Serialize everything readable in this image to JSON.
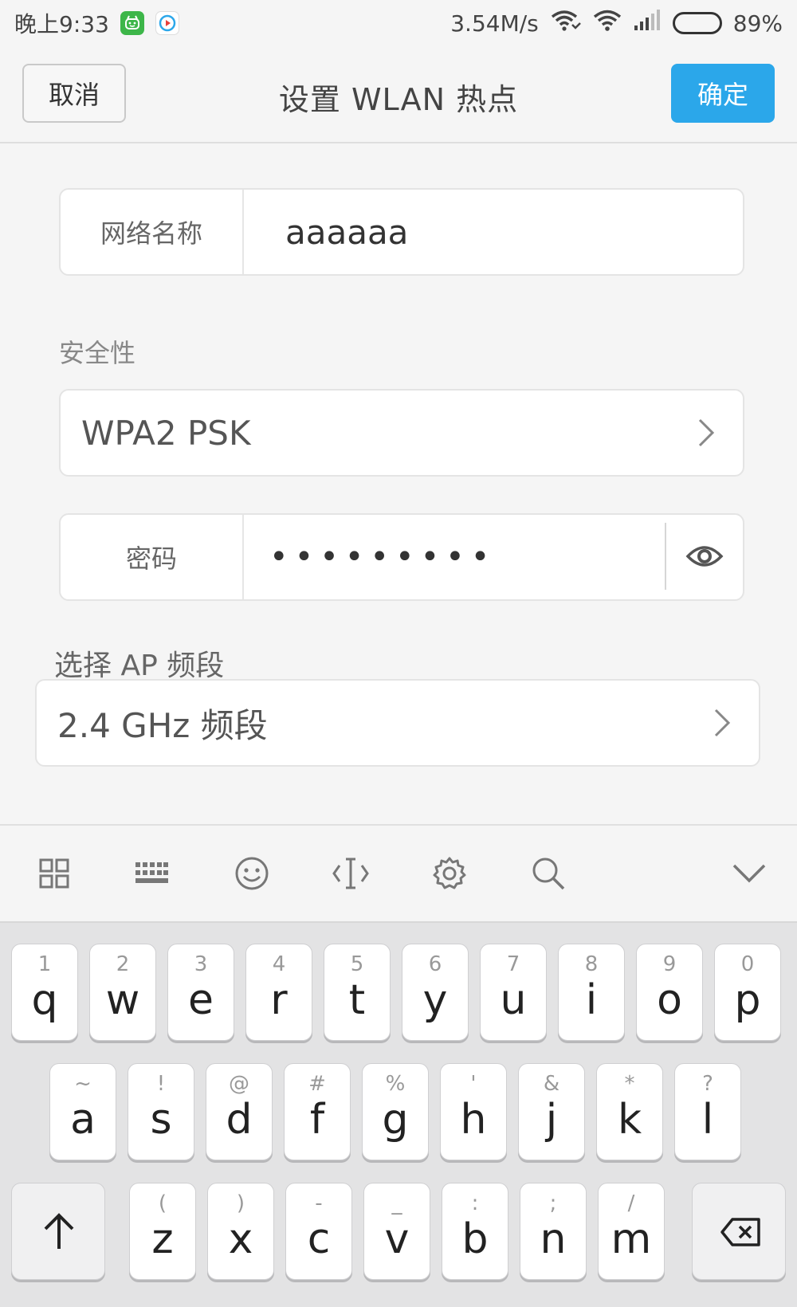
{
  "status": {
    "time": "晚上9:33",
    "speed": "3.54M/s",
    "battery": "89%",
    "battery_level": 0.89
  },
  "header": {
    "cancel_label": "取消",
    "title": "设置 WLAN 热点",
    "ok_label": "确定"
  },
  "form": {
    "network_name_label": "网络名称",
    "network_name_value": "aaaaaa",
    "security_label": "安全性",
    "security_value": "WPA2 PSK",
    "password_label": "密码",
    "password_value": "•••••••••",
    "ap_band_label": "选择 AP 频段",
    "ap_band_value": "2.4 GHz 频段"
  },
  "keyboard": {
    "row1": [
      {
        "num": "1",
        "ch": "q"
      },
      {
        "num": "2",
        "ch": "w"
      },
      {
        "num": "3",
        "ch": "e"
      },
      {
        "num": "4",
        "ch": "r"
      },
      {
        "num": "5",
        "ch": "t"
      },
      {
        "num": "6",
        "ch": "y"
      },
      {
        "num": "7",
        "ch": "u"
      },
      {
        "num": "8",
        "ch": "i"
      },
      {
        "num": "9",
        "ch": "o"
      },
      {
        "num": "0",
        "ch": "p"
      }
    ],
    "row2": [
      {
        "num": "~",
        "ch": "a"
      },
      {
        "num": "!",
        "ch": "s"
      },
      {
        "num": "@",
        "ch": "d"
      },
      {
        "num": "#",
        "ch": "f"
      },
      {
        "num": "%",
        "ch": "g"
      },
      {
        "num": "'",
        "ch": "h"
      },
      {
        "num": "&",
        "ch": "j"
      },
      {
        "num": "*",
        "ch": "k"
      },
      {
        "num": "?",
        "ch": "l"
      }
    ],
    "row3": [
      {
        "num": "(",
        "ch": "z"
      },
      {
        "num": ")",
        "ch": "x"
      },
      {
        "num": "-",
        "ch": "c"
      },
      {
        "num": "_",
        "ch": "v"
      },
      {
        "num": ":",
        "ch": "b"
      },
      {
        "num": ";",
        "ch": "n"
      },
      {
        "num": "/",
        "ch": "m"
      }
    ]
  },
  "colors": {
    "accent": "#2ba7ea",
    "wechat_green": "#3db649"
  }
}
